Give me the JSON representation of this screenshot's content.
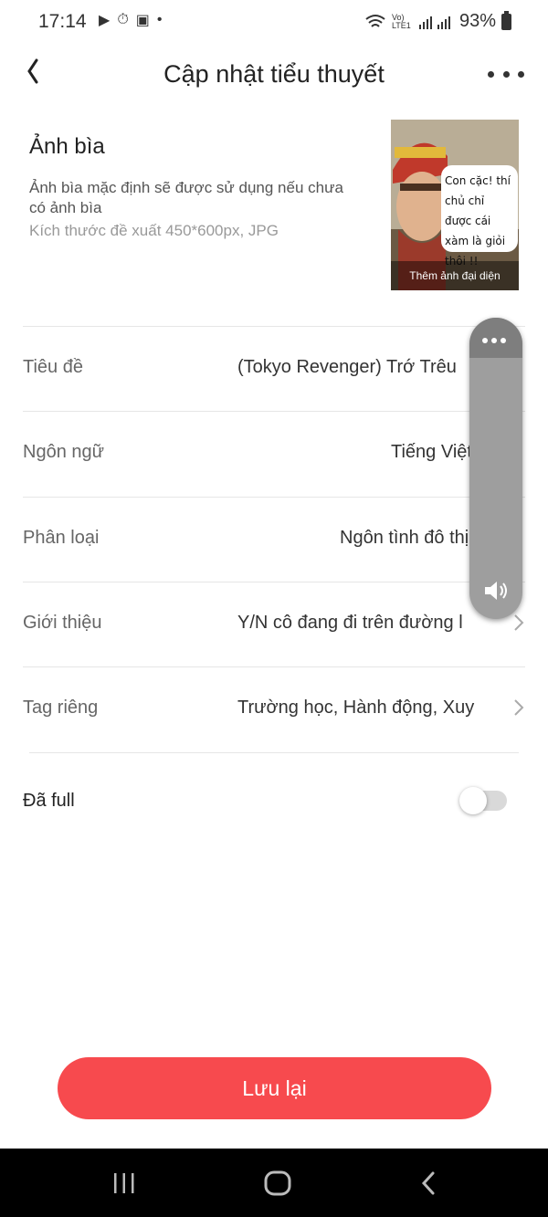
{
  "status_bar": {
    "time": "17:14",
    "battery": "93%",
    "network_label": "Vo) LTE1"
  },
  "header": {
    "title": "Cập nhật tiểu thuyết",
    "back_icon": "chevron-left-icon",
    "more_icon": "more-horizontal-icon"
  },
  "cover": {
    "title": "Ảnh bìa",
    "description": "Ảnh bìa mặc định sẽ được sử dụng nếu chưa có ảnh bìa",
    "size_hint": "Kích thước đề xuất 450*600px, JPG",
    "image_caption": "Thêm ảnh đại diện",
    "image_bubble_text": "Con cặc! thí chủ chỉ được cái xàm là giỏi thôi !!"
  },
  "fields": [
    {
      "label": "Tiêu đề",
      "value": "(Tokyo Revenger) Trớ Trêu"
    },
    {
      "label": "Ngôn ngữ",
      "value": "Tiếng Việt"
    },
    {
      "label": "Phân loại",
      "value": "Ngôn tình đô thị"
    },
    {
      "label": "Giới thiệu",
      "value": "Y/N cô đang đi trên đường l"
    },
    {
      "label": "Tag riêng",
      "value": "Trường học, Hành động, Xuy"
    }
  ],
  "full_toggle": {
    "label": "Đã full",
    "enabled": false
  },
  "save_button": {
    "label": "Lưu lại",
    "color": "#f74a4e"
  }
}
